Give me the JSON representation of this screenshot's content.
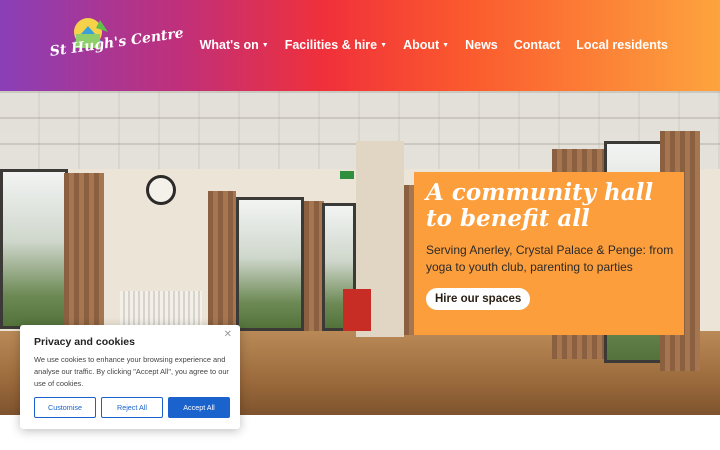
{
  "header": {
    "logo_text": "St Hugh's Centre",
    "nav": [
      {
        "label": "What's on",
        "dropdown": true
      },
      {
        "label": "Facilities & hire",
        "dropdown": true
      },
      {
        "label": "About",
        "dropdown": true
      },
      {
        "label": "News",
        "dropdown": false
      },
      {
        "label": "Contact",
        "dropdown": false
      },
      {
        "label": "Local residents",
        "dropdown": false
      }
    ],
    "colors": {
      "gradient_start": "#8a3fb8",
      "gradient_mid": "#f0303a",
      "gradient_end": "#fda43e"
    }
  },
  "hero": {
    "title_line1": "A community hall",
    "title_line2": "to benefit all",
    "subtitle": "Serving Anerley, Crystal Palace & Penge: from yoga to youth club, parenting to parties",
    "cta_label": "Hire our spaces",
    "panel_color": "#fc9e3c"
  },
  "cookie_banner": {
    "title": "Privacy and cookies",
    "body": "We use cookies to enhance your browsing experience and analyse our traffic. By clicking \"Accept All\", you agree to our use of cookies.",
    "close_icon": "close-icon",
    "buttons": {
      "customise": "Customise",
      "reject": "Reject All",
      "accept": "Accept All"
    },
    "accent_color": "#1a63cc"
  }
}
